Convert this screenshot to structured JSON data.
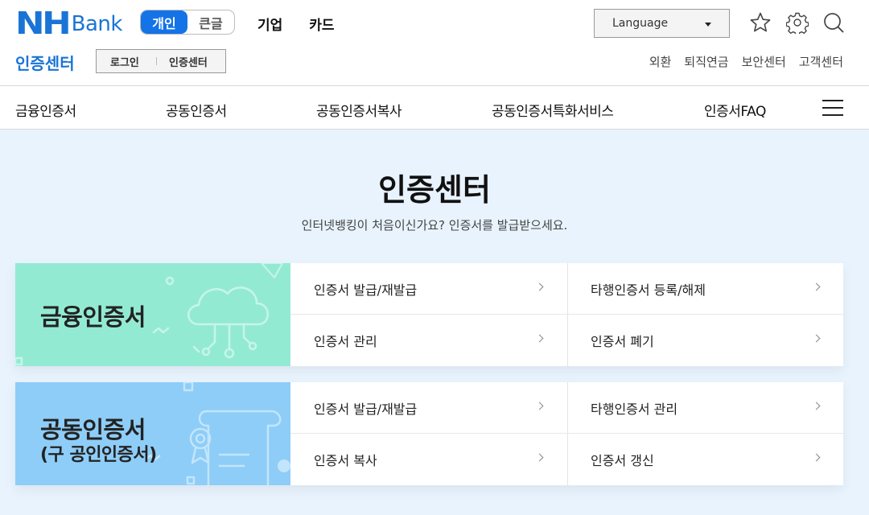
{
  "brand": {
    "logo_nh": "NH",
    "logo_bank": "Bank",
    "color": "#1a74d6"
  },
  "view_toggle": [
    {
      "label": "개인",
      "active": true
    },
    {
      "label": "큰글",
      "active": false
    }
  ],
  "top_nav": [
    "기업",
    "카드"
  ],
  "language": {
    "label": "Language"
  },
  "header_icons": [
    "star-icon",
    "gear-icon",
    "search-icon"
  ],
  "section_title": "인증센터",
  "sub_buttons": [
    "로그인",
    "인증센터"
  ],
  "utility_links": [
    "외환",
    "퇴직연금",
    "보안센터",
    "고객센터"
  ],
  "main_nav": [
    "금융인증서",
    "공동인증서",
    "공동인증서복사",
    "공동인증서특화서비스",
    "인증서FAQ"
  ],
  "page": {
    "title": "인증센터",
    "subtitle": "인터넷뱅킹이 처음이신가요? 인증서를 발급받으세요."
  },
  "cards": [
    {
      "title": "금융인증서",
      "subtitle": "",
      "color": "#93ead3",
      "links": [
        "인증서 발급/재발급",
        "타행인증서 등록/해제",
        "인증서 관리",
        "인증서 폐기"
      ]
    },
    {
      "title": "공동인증서",
      "subtitle": "(구 공인인증서)",
      "color": "#8ecdf7",
      "links": [
        "인증서 발급/재발급",
        "타행인증서 관리",
        "인증서 복사",
        "인증서 갱신"
      ]
    }
  ]
}
